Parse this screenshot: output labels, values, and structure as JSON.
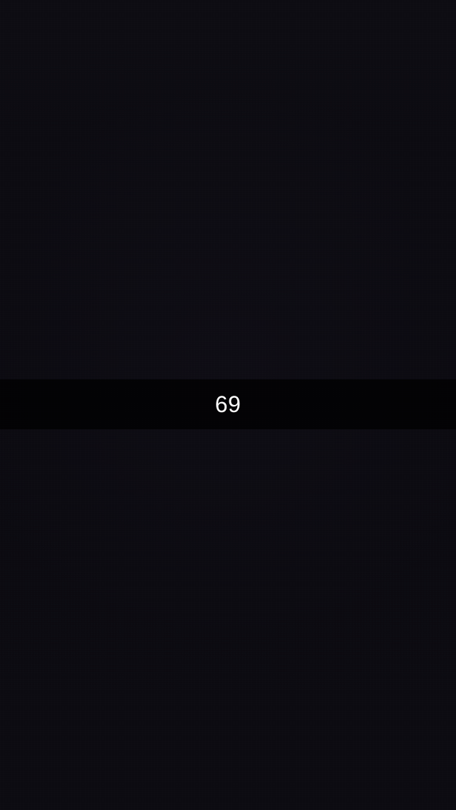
{
  "caption": {
    "text": "69"
  },
  "colors": {
    "background": "#0b0a10",
    "caption_bar": "#000000",
    "caption_text": "#ffffff"
  }
}
